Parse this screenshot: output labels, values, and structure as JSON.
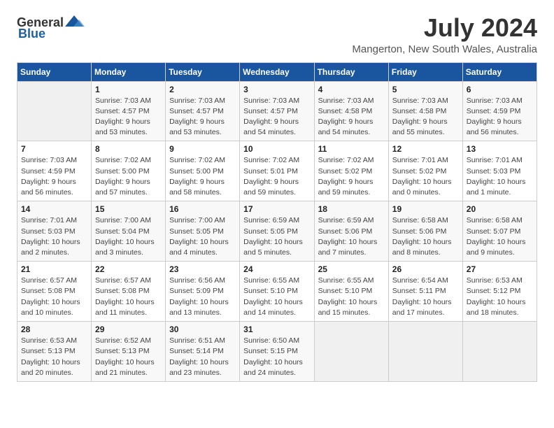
{
  "header": {
    "logo_general": "General",
    "logo_blue": "Blue",
    "title": "July 2024",
    "location": "Mangerton, New South Wales, Australia"
  },
  "days_of_week": [
    "Sunday",
    "Monday",
    "Tuesday",
    "Wednesday",
    "Thursday",
    "Friday",
    "Saturday"
  ],
  "weeks": [
    [
      {
        "day": "",
        "info": ""
      },
      {
        "day": "1",
        "info": "Sunrise: 7:03 AM\nSunset: 4:57 PM\nDaylight: 9 hours\nand 53 minutes."
      },
      {
        "day": "2",
        "info": "Sunrise: 7:03 AM\nSunset: 4:57 PM\nDaylight: 9 hours\nand 53 minutes."
      },
      {
        "day": "3",
        "info": "Sunrise: 7:03 AM\nSunset: 4:57 PM\nDaylight: 9 hours\nand 54 minutes."
      },
      {
        "day": "4",
        "info": "Sunrise: 7:03 AM\nSunset: 4:58 PM\nDaylight: 9 hours\nand 54 minutes."
      },
      {
        "day": "5",
        "info": "Sunrise: 7:03 AM\nSunset: 4:58 PM\nDaylight: 9 hours\nand 55 minutes."
      },
      {
        "day": "6",
        "info": "Sunrise: 7:03 AM\nSunset: 4:59 PM\nDaylight: 9 hours\nand 56 minutes."
      }
    ],
    [
      {
        "day": "7",
        "info": "Sunrise: 7:03 AM\nSunset: 4:59 PM\nDaylight: 9 hours\nand 56 minutes."
      },
      {
        "day": "8",
        "info": "Sunrise: 7:02 AM\nSunset: 5:00 PM\nDaylight: 9 hours\nand 57 minutes."
      },
      {
        "day": "9",
        "info": "Sunrise: 7:02 AM\nSunset: 5:00 PM\nDaylight: 9 hours\nand 58 minutes."
      },
      {
        "day": "10",
        "info": "Sunrise: 7:02 AM\nSunset: 5:01 PM\nDaylight: 9 hours\nand 59 minutes."
      },
      {
        "day": "11",
        "info": "Sunrise: 7:02 AM\nSunset: 5:02 PM\nDaylight: 9 hours\nand 59 minutes."
      },
      {
        "day": "12",
        "info": "Sunrise: 7:01 AM\nSunset: 5:02 PM\nDaylight: 10 hours\nand 0 minutes."
      },
      {
        "day": "13",
        "info": "Sunrise: 7:01 AM\nSunset: 5:03 PM\nDaylight: 10 hours\nand 1 minute."
      }
    ],
    [
      {
        "day": "14",
        "info": "Sunrise: 7:01 AM\nSunset: 5:03 PM\nDaylight: 10 hours\nand 2 minutes."
      },
      {
        "day": "15",
        "info": "Sunrise: 7:00 AM\nSunset: 5:04 PM\nDaylight: 10 hours\nand 3 minutes."
      },
      {
        "day": "16",
        "info": "Sunrise: 7:00 AM\nSunset: 5:05 PM\nDaylight: 10 hours\nand 4 minutes."
      },
      {
        "day": "17",
        "info": "Sunrise: 6:59 AM\nSunset: 5:05 PM\nDaylight: 10 hours\nand 5 minutes."
      },
      {
        "day": "18",
        "info": "Sunrise: 6:59 AM\nSunset: 5:06 PM\nDaylight: 10 hours\nand 7 minutes."
      },
      {
        "day": "19",
        "info": "Sunrise: 6:58 AM\nSunset: 5:06 PM\nDaylight: 10 hours\nand 8 minutes."
      },
      {
        "day": "20",
        "info": "Sunrise: 6:58 AM\nSunset: 5:07 PM\nDaylight: 10 hours\nand 9 minutes."
      }
    ],
    [
      {
        "day": "21",
        "info": "Sunrise: 6:57 AM\nSunset: 5:08 PM\nDaylight: 10 hours\nand 10 minutes."
      },
      {
        "day": "22",
        "info": "Sunrise: 6:57 AM\nSunset: 5:08 PM\nDaylight: 10 hours\nand 11 minutes."
      },
      {
        "day": "23",
        "info": "Sunrise: 6:56 AM\nSunset: 5:09 PM\nDaylight: 10 hours\nand 13 minutes."
      },
      {
        "day": "24",
        "info": "Sunrise: 6:55 AM\nSunset: 5:10 PM\nDaylight: 10 hours\nand 14 minutes."
      },
      {
        "day": "25",
        "info": "Sunrise: 6:55 AM\nSunset: 5:10 PM\nDaylight: 10 hours\nand 15 minutes."
      },
      {
        "day": "26",
        "info": "Sunrise: 6:54 AM\nSunset: 5:11 PM\nDaylight: 10 hours\nand 17 minutes."
      },
      {
        "day": "27",
        "info": "Sunrise: 6:53 AM\nSunset: 5:12 PM\nDaylight: 10 hours\nand 18 minutes."
      }
    ],
    [
      {
        "day": "28",
        "info": "Sunrise: 6:53 AM\nSunset: 5:13 PM\nDaylight: 10 hours\nand 20 minutes."
      },
      {
        "day": "29",
        "info": "Sunrise: 6:52 AM\nSunset: 5:13 PM\nDaylight: 10 hours\nand 21 minutes."
      },
      {
        "day": "30",
        "info": "Sunrise: 6:51 AM\nSunset: 5:14 PM\nDaylight: 10 hours\nand 23 minutes."
      },
      {
        "day": "31",
        "info": "Sunrise: 6:50 AM\nSunset: 5:15 PM\nDaylight: 10 hours\nand 24 minutes."
      },
      {
        "day": "",
        "info": ""
      },
      {
        "day": "",
        "info": ""
      },
      {
        "day": "",
        "info": ""
      }
    ]
  ]
}
